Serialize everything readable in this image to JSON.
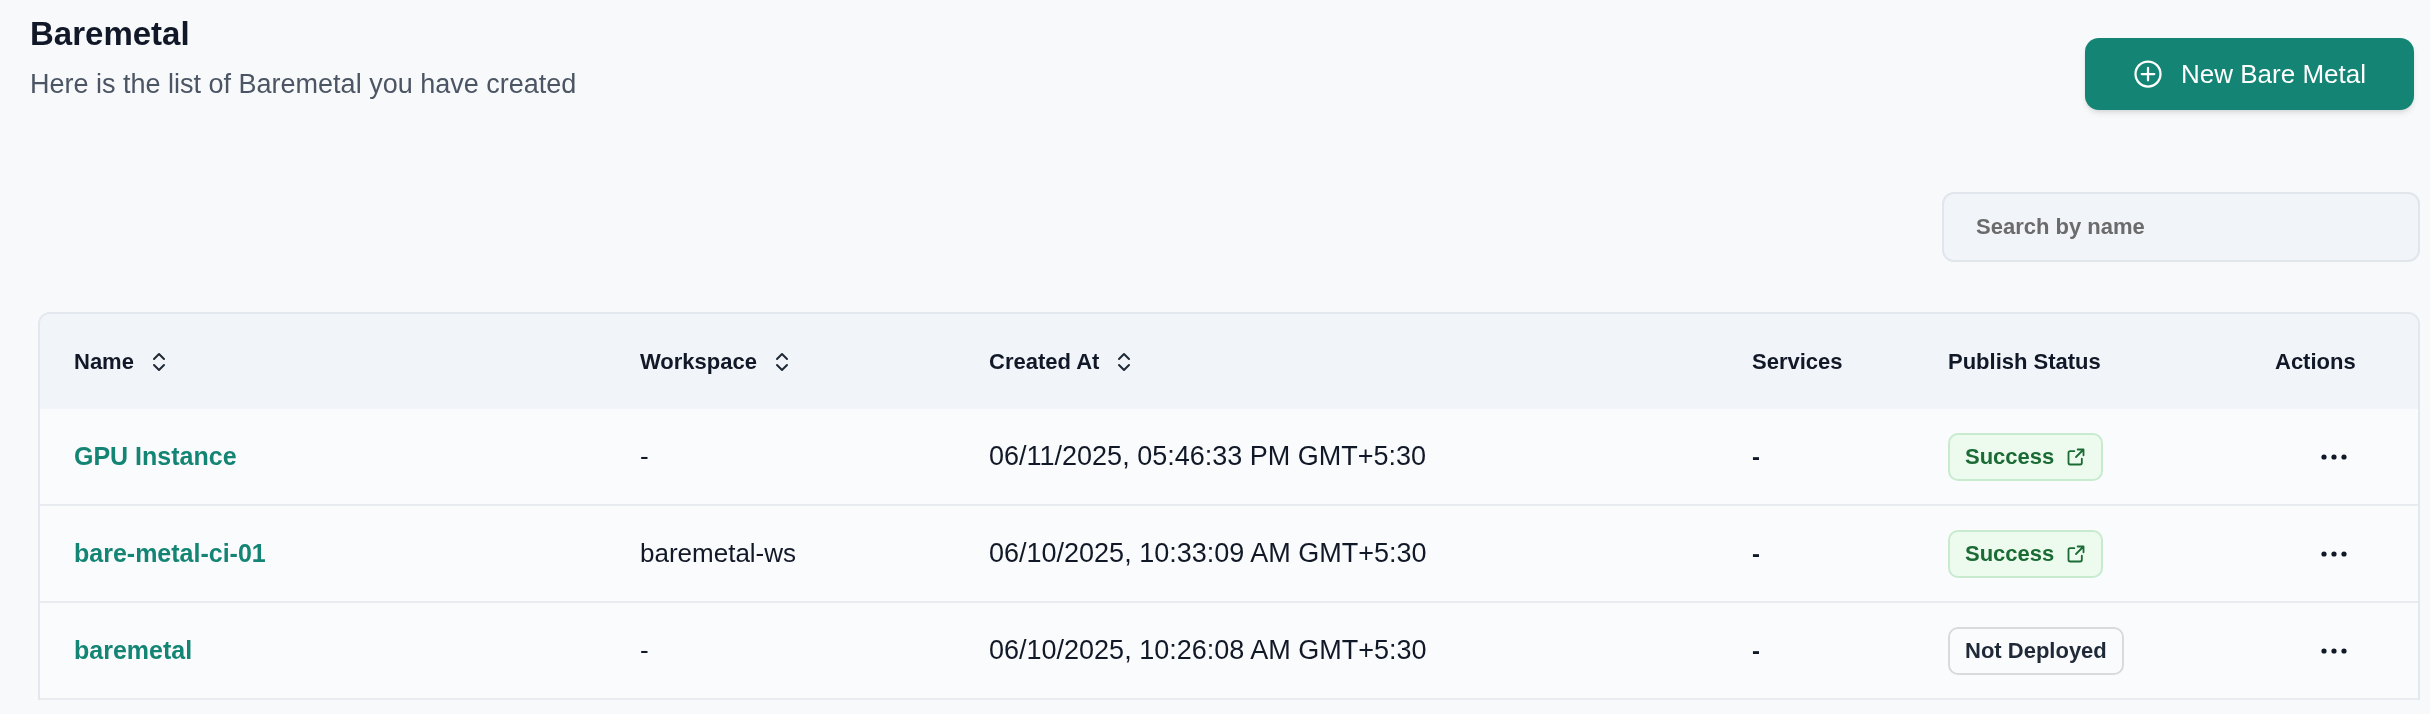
{
  "header": {
    "title": "Baremetal",
    "subtitle": "Here is the list of Baremetal you have created"
  },
  "new_button": {
    "label": "New Bare Metal"
  },
  "search": {
    "placeholder": "Search by name"
  },
  "table": {
    "columns": [
      {
        "label": "Name",
        "sortable": true
      },
      {
        "label": "Workspace",
        "sortable": true
      },
      {
        "label": "Created At",
        "sortable": true
      },
      {
        "label": "Services",
        "sortable": false
      },
      {
        "label": "Publish Status",
        "sortable": false
      },
      {
        "label": "Actions",
        "sortable": false
      }
    ],
    "rows": [
      {
        "name": "GPU Instance",
        "workspace": "-",
        "created_at": "06/11/2025, 05:46:33 PM GMT+5:30",
        "services": "-",
        "status": {
          "label": "Success",
          "kind": "success"
        }
      },
      {
        "name": "bare-metal-ci-01",
        "workspace": "baremetal-ws",
        "created_at": "06/10/2025, 10:33:09 AM GMT+5:30",
        "services": "-",
        "status": {
          "label": "Success",
          "kind": "success"
        }
      },
      {
        "name": "baremetal",
        "workspace": "-",
        "created_at": "06/10/2025, 10:26:08 AM GMT+5:30",
        "services": "-",
        "status": {
          "label": "Not Deployed",
          "kind": "not_deployed"
        }
      }
    ]
  }
}
